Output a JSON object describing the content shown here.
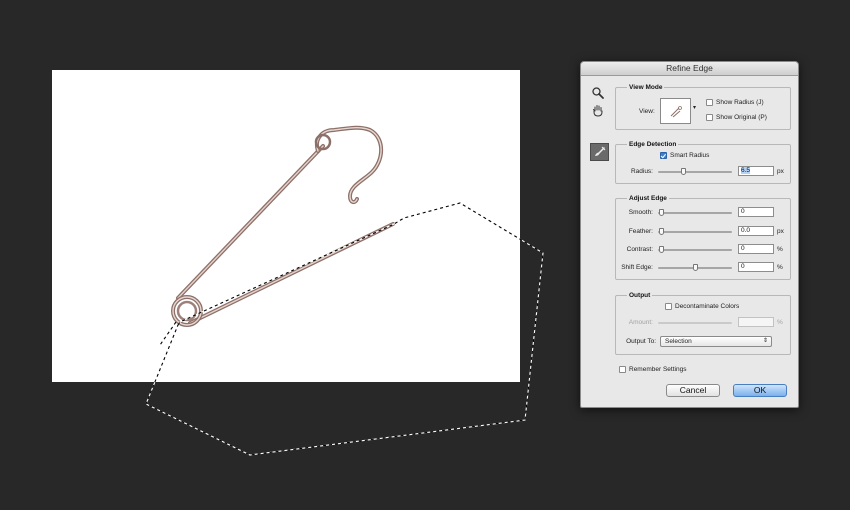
{
  "dialog": {
    "title": "Refine Edge",
    "tools": [
      {
        "icon": "zoom-icon"
      },
      {
        "icon": "hand-icon"
      },
      {
        "icon": "refine-radius-brush-icon",
        "selected": true
      }
    ],
    "view_mode": {
      "title": "View Mode",
      "view_label": "View:",
      "show_radius": {
        "label": "Show Radius (J)",
        "checked": false
      },
      "show_original": {
        "label": "Show Original (P)",
        "checked": false
      }
    },
    "edge_detection": {
      "title": "Edge Detection",
      "smart_radius": {
        "label": "Smart Radius",
        "checked": true
      },
      "radius": {
        "label": "Radius:",
        "value": "6.5",
        "unit": "px",
        "level": 0.33
      }
    },
    "adjust_edge": {
      "title": "Adjust Edge",
      "smooth": {
        "label": "Smooth:",
        "value": "0",
        "unit": "",
        "level": 0.0
      },
      "feather": {
        "label": "Feather:",
        "value": "0.0",
        "unit": "px",
        "level": 0.0
      },
      "contrast": {
        "label": "Contrast:",
        "value": "0",
        "unit": "%",
        "level": 0.0
      },
      "shift_edge": {
        "label": "Shift Edge:",
        "value": "0",
        "unit": "%",
        "level": 0.5
      }
    },
    "output": {
      "title": "Output",
      "decontaminate": {
        "label": "Decontaminate Colors",
        "checked": false
      },
      "amount": {
        "label": "Amount:",
        "value": "",
        "unit": "%",
        "disabled": true
      },
      "output_to": {
        "label": "Output To:",
        "value": "Selection"
      }
    },
    "remember": {
      "label": "Remember Settings",
      "checked": false
    },
    "buttons": {
      "cancel": "Cancel",
      "ok": "OK"
    }
  },
  "colors": {
    "workspace": "#282828",
    "document": "#ffffff",
    "accent": "#3c7fd0"
  }
}
